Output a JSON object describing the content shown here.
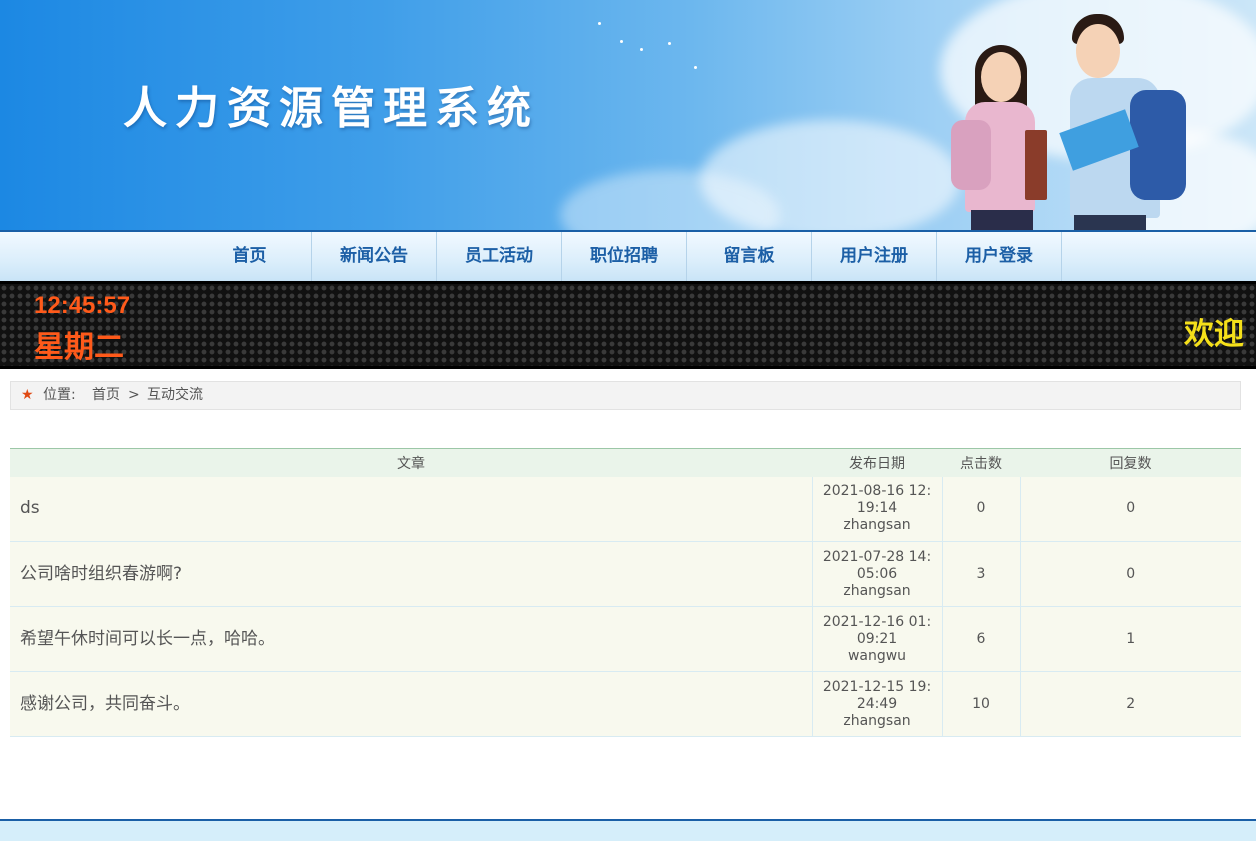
{
  "header": {
    "title": "人力资源管理系统"
  },
  "nav": {
    "items": [
      {
        "label": "首页"
      },
      {
        "label": "新闻公告"
      },
      {
        "label": "员工活动"
      },
      {
        "label": "职位招聘"
      },
      {
        "label": "留言板"
      },
      {
        "label": "用户注册"
      },
      {
        "label": "用户登录"
      }
    ]
  },
  "ticker": {
    "time": "12:45:57",
    "weekday": "星期二",
    "welcome": "欢迎"
  },
  "breadcrumb": {
    "label": "位置:",
    "home": "首页",
    "separator": ">",
    "current": "互动交流"
  },
  "table": {
    "headers": [
      "文章",
      "发布日期",
      "点击数",
      "回复数"
    ],
    "rows": [
      {
        "title": "ds",
        "date_line1": "2021-08-16 12:",
        "date_line2": "19:14",
        "author": "zhangsan",
        "clicks": "0",
        "replies": "0"
      },
      {
        "title": "公司啥时组织春游啊?",
        "date_line1": "2021-07-28 14:",
        "date_line2": "05:06",
        "author": "zhangsan",
        "clicks": "3",
        "replies": "0"
      },
      {
        "title": "希望午休时间可以长一点，哈哈。",
        "date_line1": "2021-12-16 01:",
        "date_line2": "09:21",
        "author": "wangwu",
        "clicks": "6",
        "replies": "1"
      },
      {
        "title": "感谢公司，共同奋斗。",
        "date_line1": "2021-12-15 19:",
        "date_line2": "24:49",
        "author": "zhangsan",
        "clicks": "10",
        "replies": "2"
      }
    ]
  },
  "colors": {
    "nav_text": "#1c5fa6",
    "led_orange": "#ff5a1a",
    "led_yellow": "#f5e01a",
    "banner_blue": "#1c88e3"
  }
}
